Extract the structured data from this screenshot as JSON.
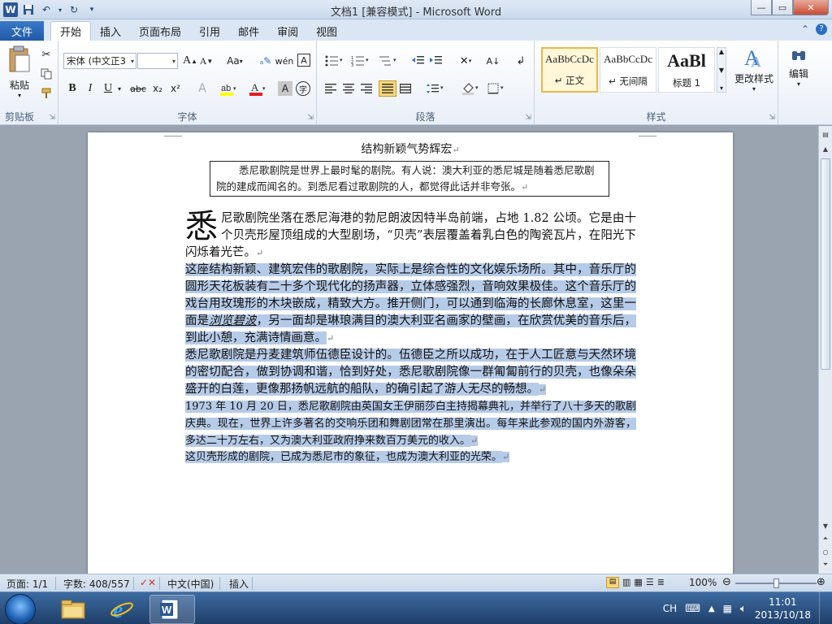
{
  "window": {
    "title": "文档1 [兼容模式] - Microsoft Word",
    "controls": {
      "minimize": "—",
      "maximize": "▭",
      "close": "✕"
    }
  },
  "tabs": {
    "file": "文件",
    "items": [
      "开始",
      "插入",
      "页面布局",
      "引用",
      "邮件",
      "审阅",
      "视图"
    ]
  },
  "ribbon": {
    "clipboard": {
      "paste": "粘贴",
      "label": "剪贴板"
    },
    "font": {
      "name": "宋体 (中文正3",
      "size": "",
      "grow": "A",
      "shrink": "A",
      "case": "Aa",
      "bold": "B",
      "italic": "I",
      "underline": "U",
      "strike": "abc",
      "subscript": "x₂",
      "superscript": "x²",
      "label": "字体"
    },
    "paragraph": {
      "label": "段落"
    },
    "styles": {
      "label": "样式",
      "items": [
        {
          "sample": "AaBbCcDc",
          "name": "↵ 正文"
        },
        {
          "sample": "AaBbCcDc",
          "name": "↵ 无间隔"
        },
        {
          "sample": "AaBl",
          "name": "标题 1"
        }
      ],
      "change": "更改样式"
    },
    "editing": {
      "label": "编辑"
    }
  },
  "document": {
    "title": "结构新颖气势辉宏",
    "textbox": "悉尼歌剧院是世界上最时髦的剧院。有人说：澳大利亚的悉尼城是随着悉尼歌剧院的建成而闻名的。到悉尼看过歌剧院的人，都觉得此话并非夸张。",
    "dropcap": "悉",
    "para1": "尼歌剧院坐落在悉尼海港的勃尼朗波因特半岛前端，占地 1.82 公顷。它是由十个贝壳形屋顶组成的大型剧场，“贝壳”表层覆盖着乳白色的陶瓷瓦片，在阳光下闪烁着光芒。",
    "para2_a": "这座结构新颖、建筑宏伟的歌剧院，实际上是综合性的文化娱乐场所。其中，音乐厅的圆形天花板装有二十多个现代化的扬声器，立体感强烈，音响效果极佳。这个音乐厅的戏台用玫瑰形的木块嵌成，精致大方。推开侧门，可以通到临海的长廊休息室，这里一面是",
    "para2_em": "浏览碧波",
    "para2_b": "，另一面却是琳琅满目的澳大利亚名画家的壁画，在欣赏优美的音乐后，到此小憩，充满诗情画意。",
    "para3": "悉尼歌剧院是丹麦建筑师伍德臣设计的。伍德臣之所以成功，在于人工匠意与天然环境的密切配合，做到协调和谐，恰到好处，悉尼歌剧院像一群匍匐前行的贝壳，也像朵朵盛开的白莲，更像那扬帆远航的船队，的确引起了游人无尽的畅想。",
    "para4": "1973 年 10 月 20 日，悉尼歌剧院由英国女王伊丽莎白主持揭幕典礼，并举行了八十多天的歌剧庆典。现在，世界上许多著名的交响乐团和舞剧团常在那里演出。每年来此参观的国内外游客，多达二十万左右，又为澳大利亚政府挣来数百万美元的收入。",
    "para5": "这贝壳形成的剧院，已成为悉尼市的象征，也成为澳大利亚的光荣。",
    "pilcrow": "↵"
  },
  "statusbar": {
    "page": "页面: 1/1",
    "words": "字数: 408/557",
    "language": "中文(中国)",
    "mode": "插入",
    "zoom": "100%",
    "zoom_level": 1.0
  },
  "taskbar": {
    "ime": "CH",
    "time": "11:01",
    "date": "2013/10/18"
  }
}
